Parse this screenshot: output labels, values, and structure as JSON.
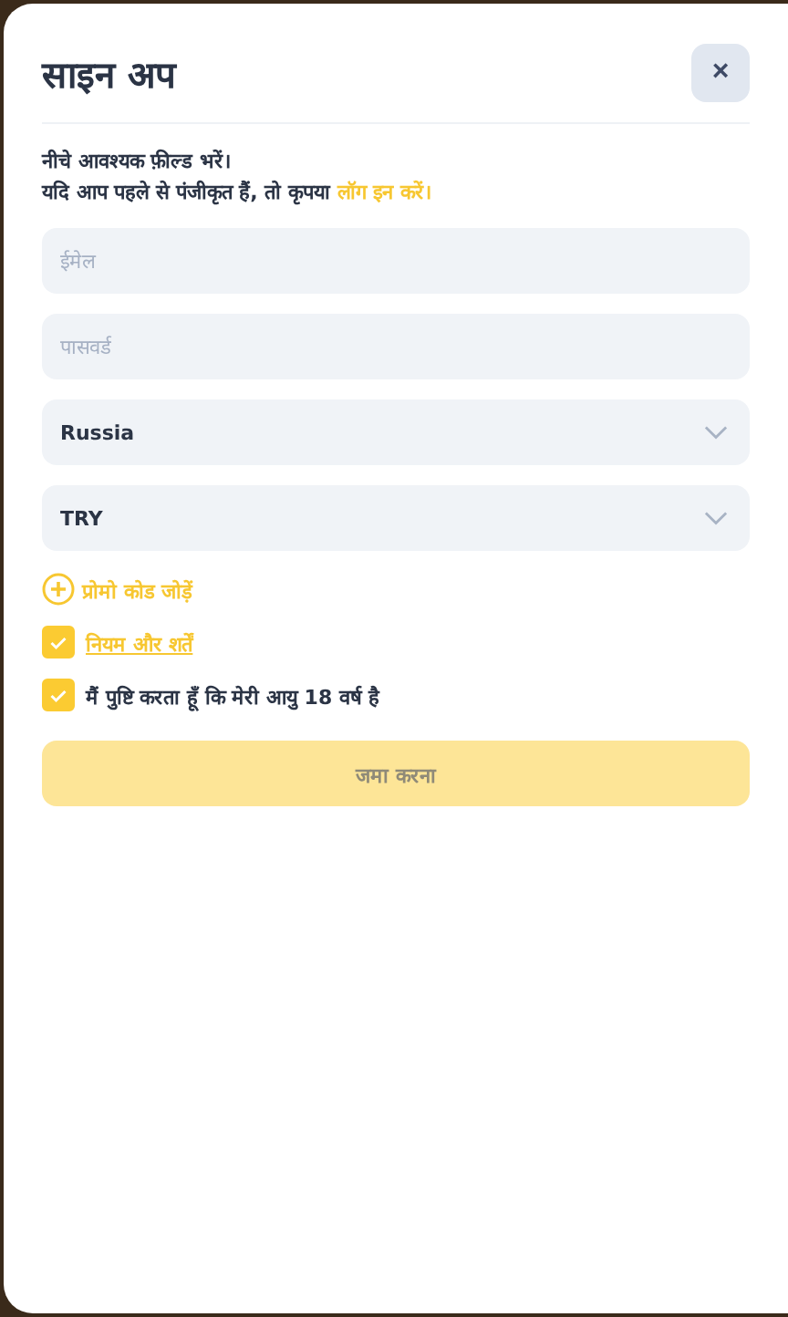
{
  "dialog": {
    "title": "साइन अप",
    "close": "×"
  },
  "intro": {
    "line1": "नीचे आवश्यक फ़ील्ड भरें।",
    "line2": "यदि आप पहले से पंजीकृत हैं, तो कृपया",
    "login_link": "लॉग इन करें।"
  },
  "fields": [
    {
      "kind": "input",
      "placeholder": "ईमेल"
    },
    {
      "kind": "input",
      "placeholder": "पासवर्ड"
    },
    {
      "kind": "select",
      "value": "Russia"
    },
    {
      "kind": "select",
      "value": "TRY"
    }
  ],
  "promo_link": "प्रोमो कोड जोड़ें",
  "checkboxes": [
    {
      "kind": "link",
      "label": "नियम और शर्तें",
      "checked": true
    },
    {
      "kind": "text",
      "label": "मैं पुष्टि करता हूँ कि मेरी आयु 18 वर्ष है",
      "checked": true
    }
  ],
  "submit": {
    "label": "जमा करना",
    "disabled": true
  }
}
